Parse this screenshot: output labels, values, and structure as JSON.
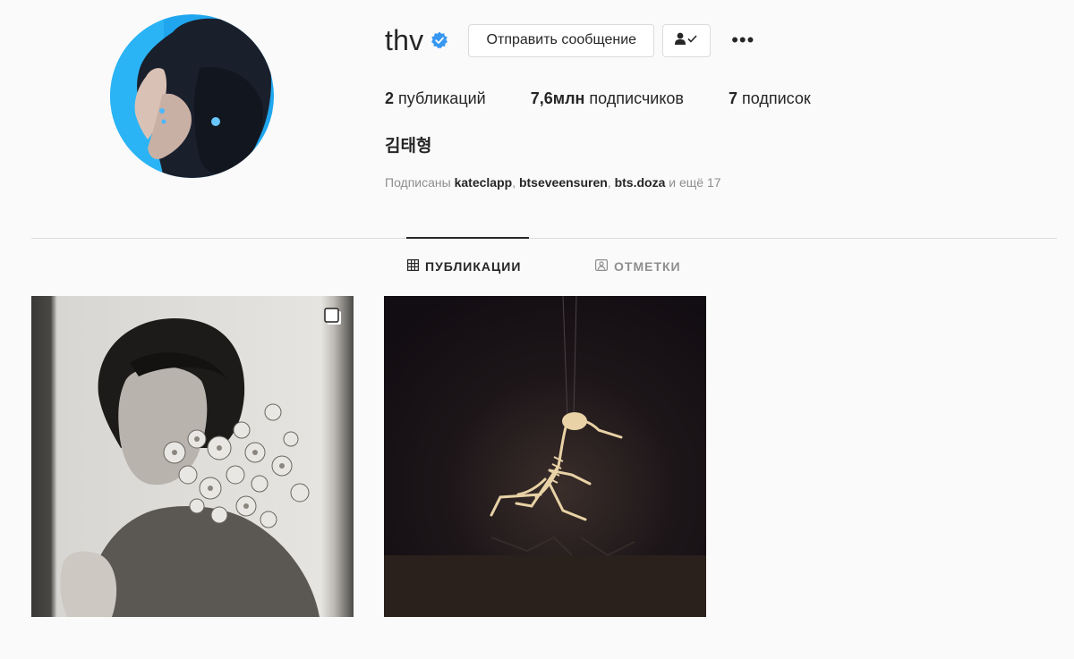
{
  "profile": {
    "username": "thv",
    "verified": true,
    "full_name": "김태형",
    "avatar_icon": "profile-avatar"
  },
  "actions": {
    "message_label": "Отправить сообщение",
    "follow_icon": "person-check-icon",
    "more_icon": "more-dots-icon",
    "more_label": "•••"
  },
  "stats": {
    "posts_value": "2",
    "posts_label": "публикаций",
    "followers_value": "7,6млн",
    "followers_label": "подписчиков",
    "following_value": "7",
    "following_label": "подписок"
  },
  "followed_by": {
    "prefix": "Подписаны",
    "users": [
      "kateclapp",
      "btseveensuren",
      "bts.doza"
    ],
    "sep1": ", ",
    "sep2": ", ",
    "suffix": "и ещё 17"
  },
  "tabs": [
    {
      "label": "ПУБЛИКАЦИИ",
      "icon": "grid-icon",
      "active": true
    },
    {
      "label": "ОТМЕТКИ",
      "icon": "tagged-icon",
      "active": false
    }
  ],
  "posts": [
    {
      "description": "black and white portrait with flowers",
      "multiple": true
    },
    {
      "description": "bird skeleton sculpture on dark background",
      "multiple": false
    }
  ],
  "colors": {
    "background": "#fafafa",
    "text": "#262626",
    "muted": "#8e8e8e",
    "border": "#dbdbdb",
    "verified": "#3897f0"
  }
}
